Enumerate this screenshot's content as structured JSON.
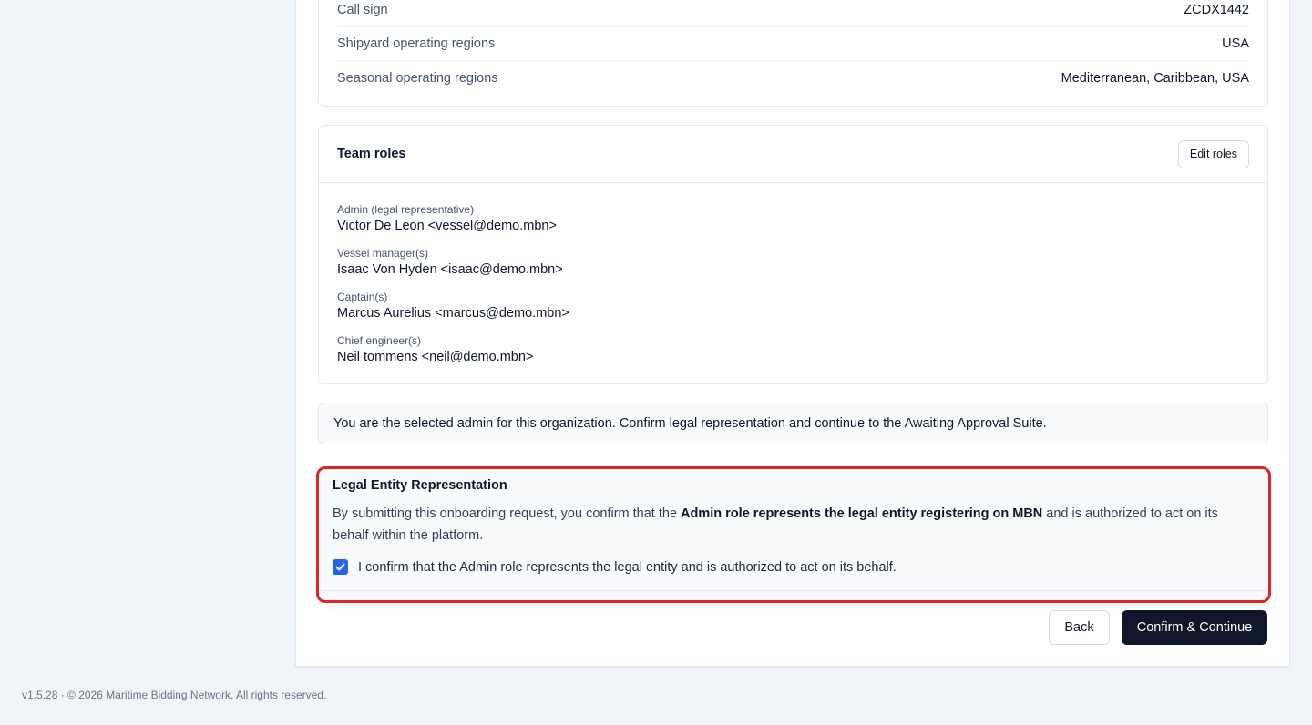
{
  "details": {
    "rows": [
      {
        "label": "Call sign",
        "value": "ZCDX1442"
      },
      {
        "label": "Shipyard operating regions",
        "value": "USA"
      },
      {
        "label": "Seasonal operating regions",
        "value": "Mediterranean, Caribbean, USA"
      }
    ]
  },
  "team_roles": {
    "title": "Team roles",
    "edit_label": "Edit roles",
    "roles": [
      {
        "label": "Admin (legal representative)",
        "value": "Victor De Leon <vessel@demo.mbn>"
      },
      {
        "label": "Vessel manager(s)",
        "value": "Isaac Von Hyden <isaac@demo.mbn>"
      },
      {
        "label": "Captain(s)",
        "value": "Marcus Aurelius <marcus@demo.mbn>"
      },
      {
        "label": "Chief engineer(s)",
        "value": "Neil tommens <neil@demo.mbn>"
      }
    ]
  },
  "info_banner": "You are the selected admin for this organization. Confirm legal representation and continue to the Awaiting Approval Suite.",
  "legal": {
    "title": "Legal Entity Representation",
    "text_before": "By submitting this onboarding request, you confirm that the ",
    "text_bold": "Admin role represents the legal entity registering on MBN",
    "text_after": " and is authorized to act on its behalf within the platform.",
    "checkbox_label": "I confirm that the Admin role represents the legal entity and is authorized to act on its behalf.",
    "checkbox_checked": true,
    "highlight_color": "#dc2626"
  },
  "actions": {
    "back_label": "Back",
    "confirm_label": "Confirm & Continue"
  },
  "footer": "v1.5.28 · © 2026 Maritime Bidding Network. All rights reserved."
}
